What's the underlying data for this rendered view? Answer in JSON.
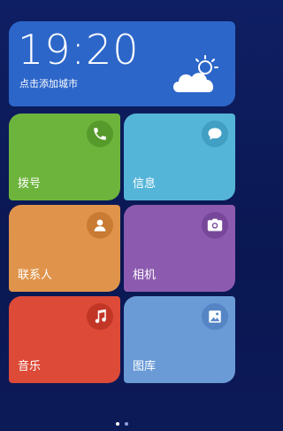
{
  "widget": {
    "time": "19:20",
    "city_prompt": "点击添加城市",
    "weather_icon": "partly-cloudy-icon"
  },
  "apps": [
    {
      "label": "拨号",
      "icon": "phone-icon",
      "color": "#6db43c"
    },
    {
      "label": "信息",
      "icon": "message-icon",
      "color": "#55b5d8"
    },
    {
      "label": "联系人",
      "icon": "contact-icon",
      "color": "#e0944b"
    },
    {
      "label": "相机",
      "icon": "camera-icon",
      "color": "#8c5aaf"
    },
    {
      "label": "音乐",
      "icon": "music-icon",
      "color": "#dd4a38"
    },
    {
      "label": "图库",
      "icon": "gallery-icon",
      "color": "#6a9bd6"
    }
  ],
  "pager": {
    "pages": 2,
    "current": 1
  }
}
